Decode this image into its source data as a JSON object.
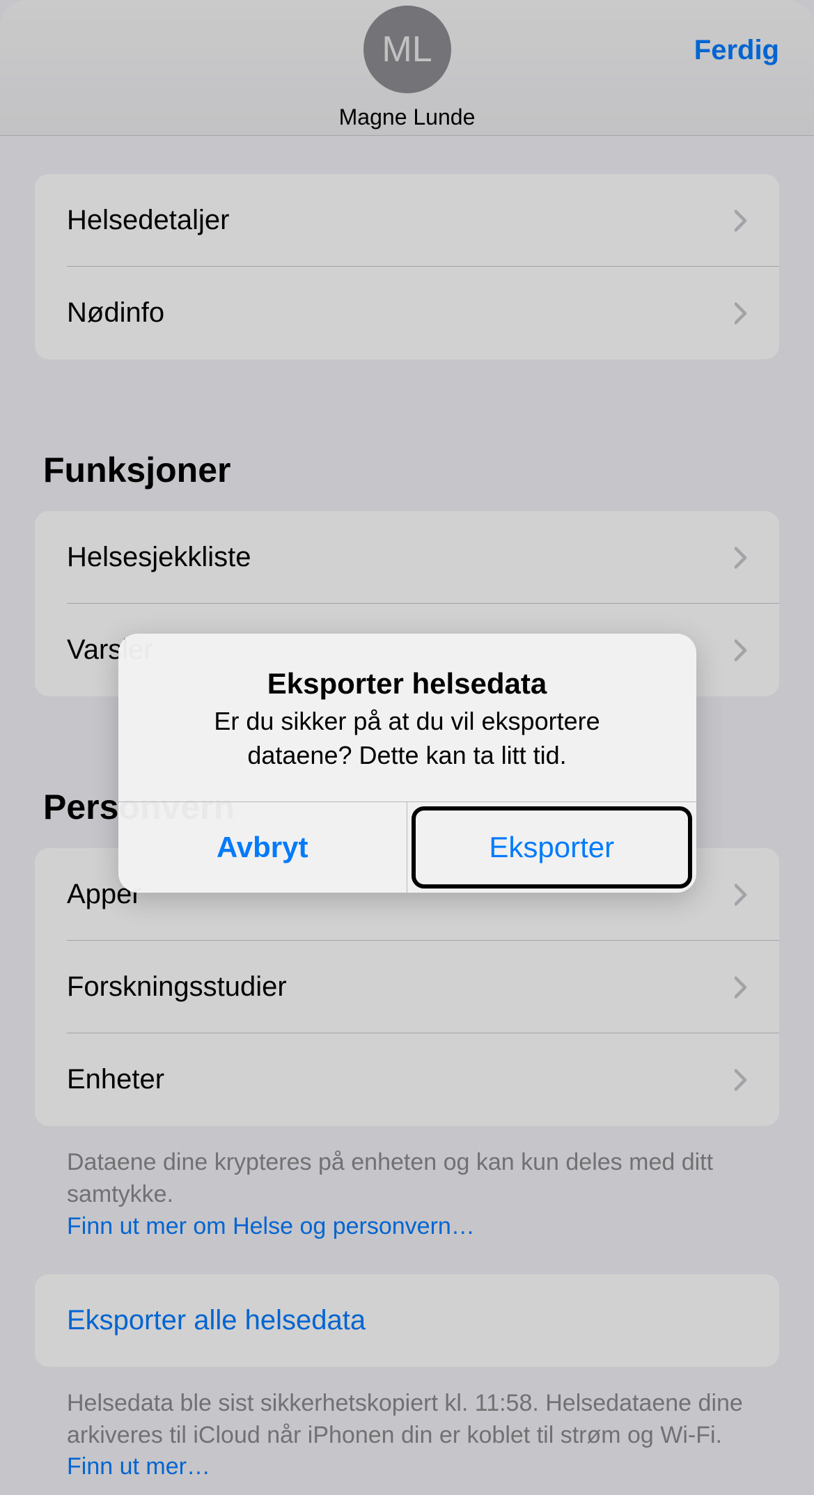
{
  "header": {
    "avatar_initials": "ML",
    "user_name": "Magne Lunde",
    "done_label": "Ferdig"
  },
  "group1": {
    "item0": "Helsedetaljer",
    "item1": "Nødinfo"
  },
  "section_functions": {
    "title": "Funksjoner",
    "item0": "Helsesjekkliste",
    "item1": "Varsler"
  },
  "section_privacy": {
    "title": "Personvern",
    "item0": "Apper",
    "item1": "Forskningsstudier",
    "item2": "Enheter"
  },
  "footer1": {
    "text": "Dataene dine krypteres på enheten og kan kun deles med ditt samtykke.",
    "link": "Finn ut mer om Helse og personvern…"
  },
  "export_row": "Eksporter alle helsedata",
  "footer2": {
    "text": "Helsedata ble sist sikkerhetskopiert kl. 11:58. Helsedataene dine arkiveres til iCloud når iPhonen din er koblet til strøm og Wi-Fi. ",
    "link": "Finn ut mer…"
  },
  "alert": {
    "title": "Eksporter helsedata",
    "message": "Er du sikker på at du vil eksportere dataene? Dette kan ta litt tid.",
    "cancel": "Avbryt",
    "confirm": "Eksporter"
  }
}
